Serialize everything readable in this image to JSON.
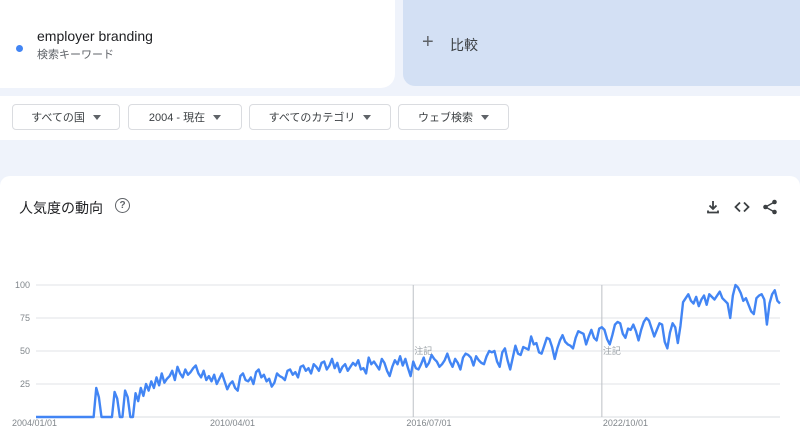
{
  "search_term": {
    "name": "employer branding",
    "subtitle": "検索キーワード",
    "color": "#4285f4"
  },
  "compare": {
    "icon": "+",
    "label": "比較"
  },
  "filters": [
    {
      "label": "すべての国"
    },
    {
      "label": "2004 - 現在"
    },
    {
      "label": "すべてのカテゴリ"
    },
    {
      "label": "ウェブ検索"
    }
  ],
  "chart_header": {
    "title": "人気度の動向",
    "help_icon": "?",
    "tools": [
      "download-icon",
      "embed-code-icon",
      "share-icon"
    ]
  },
  "chart_data": {
    "type": "line",
    "title": "人気度の動向",
    "xlabel": "",
    "ylabel": "",
    "ylim": [
      0,
      100
    ],
    "y_ticks": [
      "100",
      "75",
      "50",
      "25"
    ],
    "x_ticks": [
      "2004/01/01",
      "2010/04/01",
      "2016/07/01",
      "2022/10/01"
    ],
    "annotations": [
      "注記",
      "注記"
    ],
    "grid": true,
    "series": [
      {
        "color": "#4285f4",
        "start": "2004-01",
        "interval": "month",
        "values": [
          0,
          0,
          0,
          0,
          0,
          0,
          0,
          0,
          0,
          0,
          0,
          0,
          0,
          0,
          0,
          0,
          0,
          0,
          0,
          0,
          0,
          0,
          0,
          22,
          15,
          0,
          0,
          0,
          0,
          0,
          19,
          14,
          0,
          0,
          20,
          15,
          0,
          0,
          18,
          12,
          22,
          16,
          25,
          20,
          27,
          22,
          30,
          24,
          33,
          26,
          29,
          31,
          35,
          28,
          38,
          33,
          30,
          36,
          32,
          34,
          37,
          39,
          33,
          30,
          35,
          28,
          31,
          27,
          32,
          25,
          29,
          33,
          27,
          21,
          25,
          27,
          22,
          20,
          31,
          33,
          28,
          27,
          30,
          25,
          34,
          36,
          30,
          32,
          27,
          29,
          23,
          26,
          33,
          31,
          30,
          28,
          35,
          36,
          32,
          34,
          30,
          38,
          39,
          35,
          37,
          33,
          40,
          38,
          35,
          41,
          42,
          36,
          39,
          44,
          37,
          41,
          34,
          38,
          40,
          35,
          38,
          41,
          39,
          43,
          36,
          37,
          33,
          45,
          40,
          42,
          39,
          36,
          44,
          41,
          35,
          31,
          38,
          43,
          40,
          46,
          39,
          44,
          37,
          31,
          42,
          37,
          36,
          40,
          45,
          38,
          41,
          47,
          44,
          42,
          38,
          40,
          43,
          48,
          42,
          38,
          44,
          41,
          36,
          45,
          48,
          47,
          45,
          39,
          46,
          43,
          41,
          40,
          46,
          50,
          49,
          50,
          42,
          38,
          49,
          52,
          43,
          36,
          45,
          54,
          48,
          47,
          53,
          52,
          51,
          61,
          55,
          56,
          49,
          48,
          54,
          60,
          59,
          53,
          44,
          52,
          58,
          62,
          57,
          55,
          54,
          52,
          60,
          65,
          64,
          63,
          55,
          61,
          66,
          60,
          58,
          67,
          68,
          66,
          59,
          55,
          62,
          70,
          72,
          71,
          63,
          60,
          67,
          66,
          70,
          65,
          58,
          66,
          72,
          75,
          73,
          67,
          61,
          66,
          71,
          70,
          57,
          52,
          64,
          71,
          68,
          56,
          69,
          87,
          90,
          93,
          88,
          86,
          91,
          84,
          89,
          92,
          85,
          93,
          91,
          89,
          92,
          95,
          90,
          88,
          86,
          75,
          92,
          100,
          98,
          94,
          88,
          90,
          85,
          80,
          78,
          90,
          92,
          93,
          89,
          70,
          86,
          93,
          96,
          88,
          86
        ]
      }
    ]
  }
}
